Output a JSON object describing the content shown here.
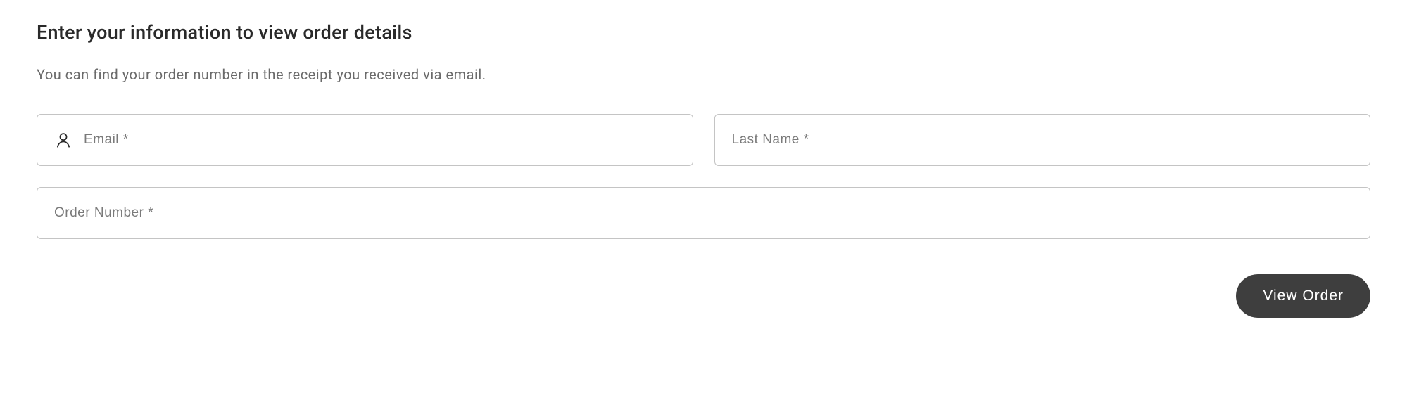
{
  "title": "Enter your information to view order details",
  "subtitle": "You can find your order number in the receipt you received via email.",
  "form": {
    "email": {
      "placeholder": "Email *",
      "value": ""
    },
    "last_name": {
      "placeholder": "Last Name *",
      "value": ""
    },
    "order_number": {
      "placeholder": "Order Number *",
      "value": ""
    }
  },
  "button": {
    "view_order": "View Order"
  }
}
